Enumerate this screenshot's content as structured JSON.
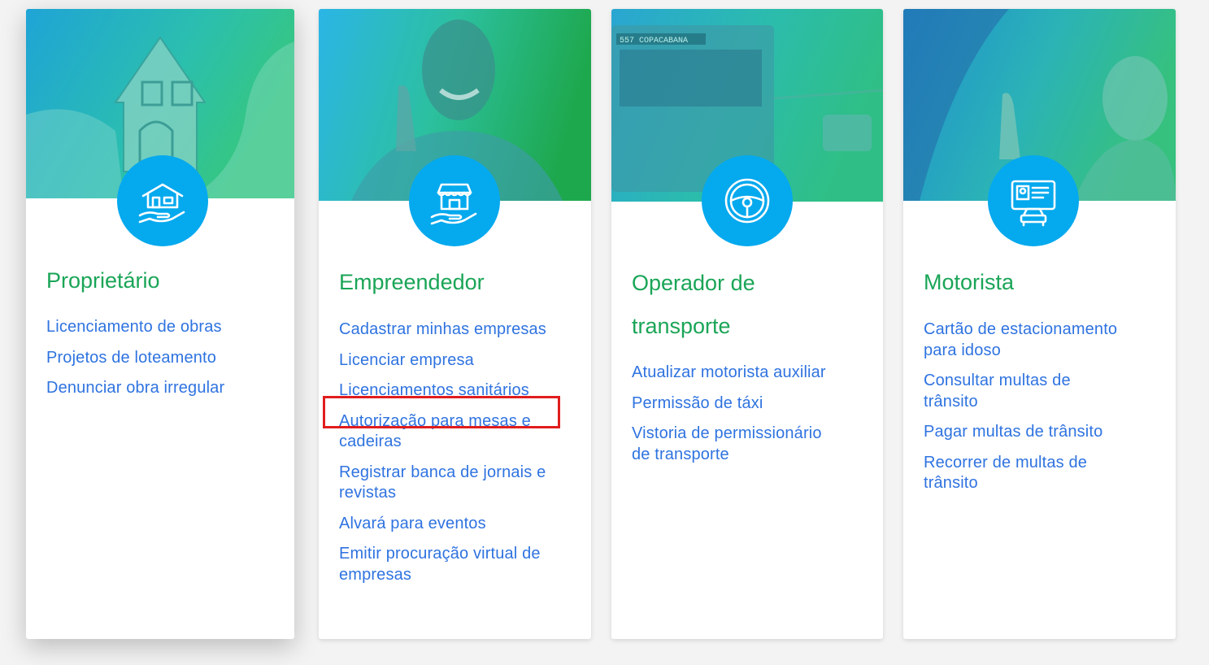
{
  "cards": [
    {
      "title": "Proprietário",
      "icon": "house-in-hand-icon",
      "image": "house-in-hands-photo",
      "links": [
        "Licenciamento de obras",
        "Projetos de loteamento",
        "Denunciar obra irregular"
      ]
    },
    {
      "title": "Empreendedor",
      "icon": "store-in-hand-icon",
      "image": "man-thumbs-up-photo",
      "links": [
        "Cadastrar minhas empresas",
        "Licenciar empresa",
        "Licenciamentos sanitários",
        "Autorização para mesas e cadeiras",
        "Registrar banca de jornais e revistas",
        "Alvará para eventos",
        "Emitir procuração virtual de empresas"
      ]
    },
    {
      "title": "Operador de transporte",
      "icon": "steering-wheel-icon",
      "image": "bus-photo",
      "links": [
        "Atualizar motorista auxiliar",
        "Permissão de táxi",
        "Vistoria de permissionário de transporte"
      ]
    },
    {
      "title": "Motorista",
      "icon": "driver-license-car-icon",
      "image": "woman-in-car-photo",
      "links": [
        "Cartão de estacionamento para idoso",
        "Consultar multas de trânsito",
        "Pagar multas de trânsito",
        "Recorrer de multas de trânsito"
      ]
    }
  ],
  "bus_sign": "557 COPACABANA",
  "colors": {
    "accent": "#05a9ee",
    "title_green": "#1aa557",
    "link_blue": "#2f73e0",
    "highlight_red": "#e11d1d"
  }
}
